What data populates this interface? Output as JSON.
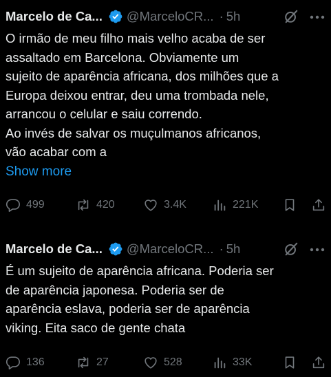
{
  "tweets": [
    {
      "display_name": "Marcelo de Ca...",
      "handle": "@MarceloCR...",
      "separator": "·",
      "time": "5h",
      "text_lines": [
        "O irmão de meu filho mais velho acaba de ser",
        "assaltado em Barcelona. Obviamente um",
        "sujeito de aparência africana, dos milhões que a",
        "Europa deixou entrar, deu uma trombada nele,",
        "arrancou o celular e saiu correndo.",
        "Ao invés de salvar os muçulmanos africanos,",
        "vão acabar com a"
      ],
      "show_more": "Show more",
      "replies": "499",
      "reposts": "420",
      "likes": "3.4K",
      "views": "221K"
    },
    {
      "display_name": "Marcelo de Ca...",
      "handle": "@MarceloCR...",
      "separator": "·",
      "time": "5h",
      "text_lines": [
        "É um sujeito de aparência africana. Poderia ser",
        "de aparência japonesa. Poderia ser de",
        "aparência eslava, poderia ser de aparência",
        "viking. Eita saco de gente chata"
      ],
      "replies": "136",
      "reposts": "27",
      "likes": "528",
      "views": "33K"
    }
  ],
  "colors": {
    "background": "#000000",
    "text": "#e7e9ea",
    "muted": "#71767b",
    "accent": "#1d9bf0"
  },
  "icons": [
    "verified-badge-icon",
    "grok-icon",
    "more-icon",
    "reply-icon",
    "repost-icon",
    "like-icon",
    "views-icon",
    "bookmark-icon",
    "share-icon"
  ]
}
